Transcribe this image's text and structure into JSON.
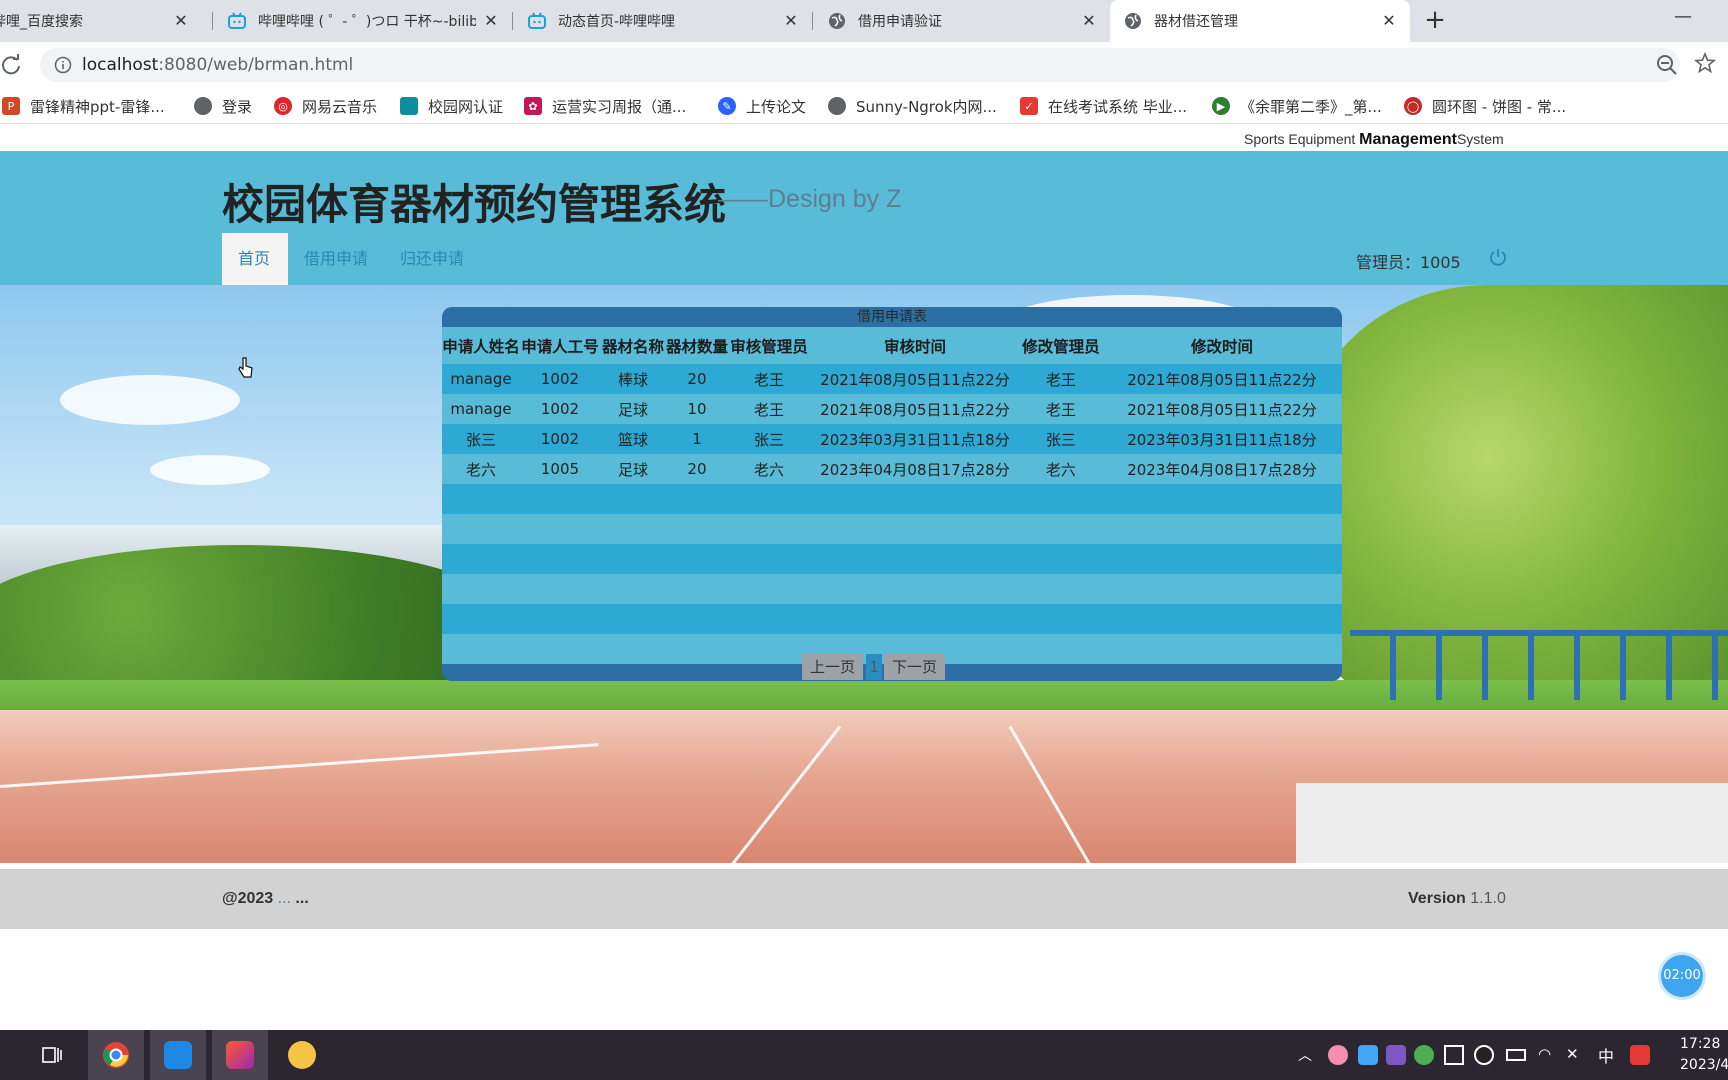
{
  "browser": {
    "tabs": [
      {
        "title": "哔哩_百度搜索",
        "icon": "paw-icon"
      },
      {
        "title": "哔哩哔哩 ( ゜- ゜)つロ 干杯~-bilibili",
        "icon": "bilibili-icon"
      },
      {
        "title": "动态首页-哔哩哔哩",
        "icon": "bilibili-icon"
      },
      {
        "title": "借用申请验证",
        "icon": "globe-icon"
      },
      {
        "title": "器材借还管理",
        "icon": "globe-icon"
      }
    ],
    "new_tab_label": "+",
    "minimize_label": "—",
    "close_label": "✕",
    "url_host": "localhost",
    "url_rest": ":8080/web/brman.html",
    "bookmarks": [
      {
        "label": "雷锋精神ppt-雷锋...",
        "icon": "ppt-icon",
        "color": "#d24726"
      },
      {
        "label": "登录",
        "icon": "globe-icon",
        "color": "#5f6368"
      },
      {
        "label": "网易云音乐",
        "icon": "netease-music-icon",
        "color": "#e0262a"
      },
      {
        "label": "校园网认证",
        "icon": "campus-net-icon",
        "color": "#0f8f9b"
      },
      {
        "label": "运营实习周报（通...",
        "icon": "flower-icon",
        "color": "#c2185b"
      },
      {
        "label": "上传论文",
        "icon": "feather-icon",
        "color": "#2962ff"
      },
      {
        "label": "Sunny-Ngrok内网...",
        "icon": "globe-icon",
        "color": "#5f6368"
      },
      {
        "label": "在线考试系统 毕业...",
        "icon": "exam-icon",
        "color": "#e53935"
      },
      {
        "label": "《余罪第二季》_第...",
        "icon": "play-icon",
        "color": "#2e7d32"
      },
      {
        "label": "圆环图 - 饼图 - 常...",
        "icon": "ring-icon",
        "color": "#c62828"
      }
    ]
  },
  "page": {
    "brand_prefix": "Sports Equipment ",
    "brand_bold": "Management",
    "brand_suffix": "System",
    "title": "校园体育器材预约管理系统",
    "subtitle": "——Design by Z",
    "nav": [
      {
        "label": "首页",
        "active": true
      },
      {
        "label": "借用申请",
        "active": false
      },
      {
        "label": "归还申请",
        "active": false
      }
    ],
    "admin_label": "管理员：1005",
    "table": {
      "caption": "借用申请表",
      "headers": [
        "申请人姓名",
        "申请人工号",
        "器材名称",
        "器材数量",
        "审核管理员",
        "审核时间",
        "修改管理员",
        "修改时间"
      ],
      "rows": [
        [
          "manage",
          "1002",
          "棒球",
          "20",
          "老王",
          "2021年08月05日11点22分",
          "老王",
          "2021年08月05日11点22分"
        ],
        [
          "manage",
          "1002",
          "足球",
          "10",
          "老王",
          "2021年08月05日11点22分",
          "老王",
          "2021年08月05日11点22分"
        ],
        [
          "张三",
          "1002",
          "篮球",
          "1",
          "张三",
          "2023年03月31日11点18分",
          "张三",
          "2023年03月31日11点18分"
        ],
        [
          "老六",
          "1005",
          "足球",
          "20",
          "老六",
          "2023年04月08日17点28分",
          "老六",
          "2023年04月08日17点28分"
        ],
        [
          "",
          "",
          "",
          "",
          "",
          "",
          "",
          ""
        ],
        [
          "",
          "",
          "",
          "",
          "",
          "",
          "",
          ""
        ],
        [
          "",
          "",
          "",
          "",
          "",
          "",
          "",
          ""
        ],
        [
          "",
          "",
          "",
          "",
          "",
          "",
          "",
          ""
        ],
        [
          "",
          "",
          "",
          "",
          "",
          "",
          "",
          ""
        ],
        [
          "",
          "",
          "",
          "",
          "",
          "",
          "",
          ""
        ]
      ],
      "prev_label": "上一页",
      "page_number": "1",
      "next_label": "下一页"
    },
    "footer": {
      "copyright": "@2023",
      "link": " ...",
      "tail": " ...",
      "version_label": "Version",
      "version_value": " 1.1.0"
    },
    "timer": "02:00"
  },
  "taskbar": {
    "clock_time": "17:28",
    "clock_date": "2023/4",
    "ime": "中",
    "apps": [
      "task-view-icon",
      "chrome-icon",
      "feishu-icon",
      "intellij-icon",
      "game-icon"
    ]
  },
  "colors": {
    "header_bg": "#58bcd9",
    "table_dark": "#2b6fa4",
    "row_odd": "#2ea9d3",
    "row_even": "#58bcd9",
    "nav_link": "#2c86b5",
    "footer_bg": "#d2d2d2"
  }
}
